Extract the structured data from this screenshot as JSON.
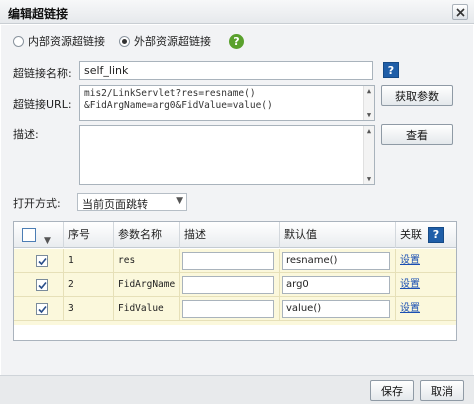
{
  "dialog": {
    "title": "编辑超链接"
  },
  "resource_type": {
    "options": [
      {
        "label": "内部资源超链接",
        "checked": false
      },
      {
        "label": "外部资源超链接",
        "checked": true
      }
    ],
    "help": "?"
  },
  "form": {
    "link_name_label": "超链接名称:",
    "link_name_value": "self_link",
    "link_name_help": "?",
    "url_label": "超链接URL:",
    "url_line1": "mis2/LinkServlet?res=resname()",
    "url_line2": "&FidArgName=arg0&FidValue=value()",
    "get_params_button": "获取参数",
    "description_label": "描述:",
    "view_button": "查看",
    "open_mode_label": "打开方式:",
    "open_mode_value": "当前页面跳转"
  },
  "params_table": {
    "columns": [
      "序号",
      "参数名称",
      "描述",
      "默认值",
      "关联"
    ],
    "help": "?",
    "rows": [
      {
        "checked": true,
        "index": "1",
        "name": "res",
        "description": "",
        "default": "resname()",
        "link": "设置"
      },
      {
        "checked": true,
        "index": "2",
        "name": "FidArgName",
        "description": "",
        "default": "arg0",
        "link": "设置"
      },
      {
        "checked": true,
        "index": "3",
        "name": "FidValue",
        "description": "",
        "default": "value()",
        "link": "设置"
      }
    ]
  },
  "footer": {
    "save_button": "保存",
    "cancel_button": "取消"
  }
}
